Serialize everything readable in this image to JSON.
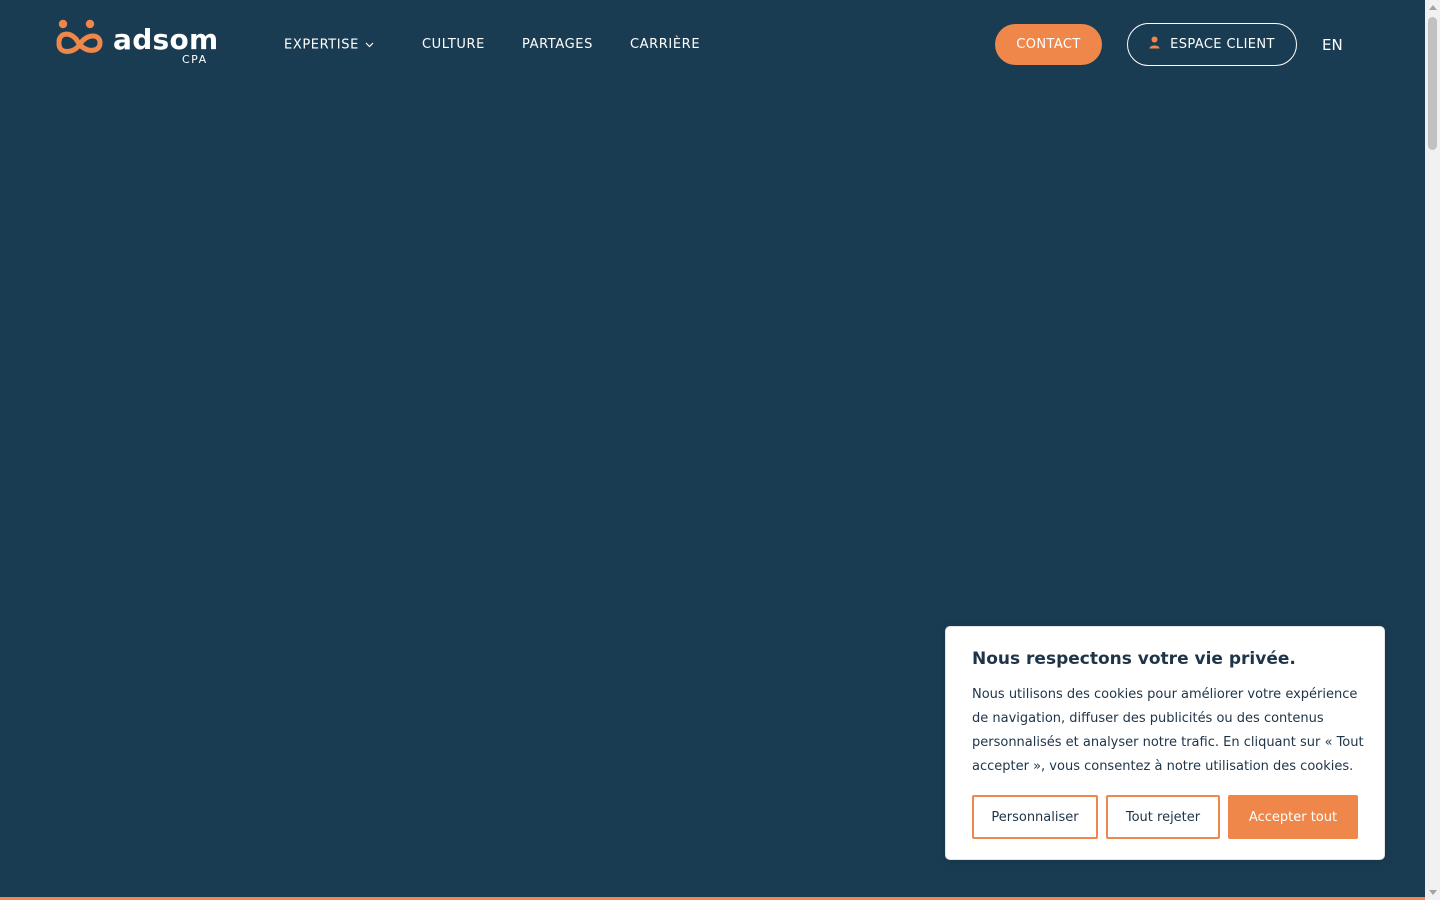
{
  "brand": {
    "name": "adsom",
    "sub": "CPA"
  },
  "nav": {
    "items": [
      {
        "label": "EXPERTISE"
      },
      {
        "label": "CULTURE"
      },
      {
        "label": "PARTAGES"
      },
      {
        "label": "CARRIÈRE"
      }
    ],
    "contact_label": "CONTACT",
    "client_label": "ESPACE CLIENT",
    "lang_label": "EN"
  },
  "cookie": {
    "title": "Nous respectons votre vie privée.",
    "text": "Nous utilisons des cookies pour améliorer votre expérience de navigation, diffuser des publicités ou des contenus personnalisés et analyser notre trafic. En cliquant sur « Tout accepter », vous consentez à notre utilisation des cookies.",
    "customize_label": "Personnaliser",
    "reject_label": "Tout rejeter",
    "accept_label": "Accepter tout"
  },
  "colors": {
    "background": "#1a3c53",
    "accent": "#f0874a",
    "text_dark": "#1e3448"
  },
  "icons": {
    "logo": "adsom-logo-icon",
    "dropdown": "chevron-down-icon",
    "client": "user-icon"
  }
}
